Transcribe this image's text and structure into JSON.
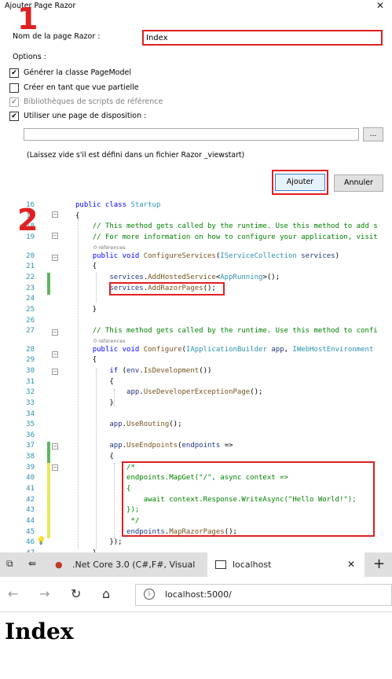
{
  "dialog": {
    "title": "Ajouter Page Razor",
    "close_glyph": "✕",
    "name_label": "Nom de la page Razor :",
    "name_value": "Index",
    "options_label": "Options :",
    "checkboxes": [
      {
        "label": "Générer la classe PageModel",
        "checked": true,
        "disabled": false
      },
      {
        "label": "Créer en tant que vue partielle",
        "checked": false,
        "disabled": false
      },
      {
        "label": "Bibliothèques de scripts de référence",
        "checked": true,
        "disabled": true
      },
      {
        "label": "Utiliser une page de disposition :",
        "checked": true,
        "disabled": false
      }
    ],
    "layout_value": "",
    "browse_label": "...",
    "hint": "(Laissez vide s'il est défini dans un fichier Razor _viewstart)",
    "add_label": "Ajouter",
    "cancel_label": "Annuler"
  },
  "annotations": {
    "step1": "1",
    "step2": "2"
  },
  "editor": {
    "codelens": "0 références",
    "lines": [
      {
        "n": "16",
        "html": "<span class='k'>public class</span> <span class='t'>Startup</span>"
      },
      {
        "n": "17",
        "html": "{"
      },
      {
        "n": "18",
        "html": "    <span class='c'>// This method gets called by the runtime. Use this method to add s</span>"
      },
      {
        "n": "19",
        "html": "    <span class='c'>// For more information on how to configure your application, visit</span>"
      },
      {
        "n": "20",
        "html": "    <span class='k'>public void</span> <span class='m'>ConfigureServices</span>(<span class='t'>IServiceCollection</span> <span class='v'>services</span>)"
      },
      {
        "n": "21",
        "html": "    {"
      },
      {
        "n": "22",
        "html": "        <span class='v'>services</span>.<span class='m'>AddHostedService</span>&lt;<span class='t'>AppRunning</span>&gt;();"
      },
      {
        "n": "23",
        "html": "        <span class='v'>services</span>.<span class='m'>AddRazorPages</span>();"
      },
      {
        "n": "24",
        "html": ""
      },
      {
        "n": "25",
        "html": "    }"
      },
      {
        "n": "26",
        "html": ""
      },
      {
        "n": "27",
        "html": "    <span class='c'>// This method gets called by the runtime. Use this method to confi</span>"
      },
      {
        "n": "28",
        "html": "    <span class='k'>public void</span> <span class='m'>Configure</span>(<span class='t'>IApplicationBuilder</span> <span class='v'>app</span>, <span class='t'>IWebHostEnvironment</span>"
      },
      {
        "n": "29",
        "html": "    {"
      },
      {
        "n": "30",
        "html": "        <span class='k'>if</span> (<span class='v'>env</span>.<span class='m'>IsDevelopment</span>())"
      },
      {
        "n": "31",
        "html": "        {"
      },
      {
        "n": "32",
        "html": "            <span class='v'>app</span>.<span class='m'>UseDeveloperExceptionPage</span>();"
      },
      {
        "n": "33",
        "html": "        }"
      },
      {
        "n": "34",
        "html": ""
      },
      {
        "n": "35",
        "html": "        <span class='v'>app</span>.<span class='m'>UseRouting</span>();"
      },
      {
        "n": "36",
        "html": ""
      },
      {
        "n": "37",
        "html": "        <span class='v'>app</span>.<span class='m'>UseEndpoints</span>(<span class='v'>endpoints</span> =&gt;"
      },
      {
        "n": "38",
        "html": "        {"
      },
      {
        "n": "39",
        "html": "            <span class='c'>/*</span>"
      },
      {
        "n": "40",
        "html": "            <span class='c'>endpoints.MapGet(\"/\", async context =&gt;</span>"
      },
      {
        "n": "41",
        "html": "            <span class='c'>{</span>"
      },
      {
        "n": "42",
        "html": "            <span class='c'>    await context.Response.WriteAsync(\"Hello World!\");</span>"
      },
      {
        "n": "43",
        "html": "            <span class='c'>});</span>"
      },
      {
        "n": "44",
        "html": "            <span class='c'> */</span>"
      },
      {
        "n": "45",
        "html": "            <span class='v'>endpoints</span>.<span class='m'>MapRazorPages</span>();"
      },
      {
        "n": "46",
        "html": "        });"
      },
      {
        "n": "47",
        "html": "    }"
      }
    ]
  },
  "browser": {
    "tab1_title": ".Net Core 3.0 (C#,F#, Visual",
    "tab2_title": "localhost",
    "tab_close": "✕",
    "new_tab": "+",
    "address": "localhost:5000/",
    "page_heading": "Index"
  },
  "colors": {
    "annotation_red": "#e02020",
    "comment_green": "#008000",
    "keyword_blue": "#0000ff",
    "type_teal": "#2b91af"
  }
}
